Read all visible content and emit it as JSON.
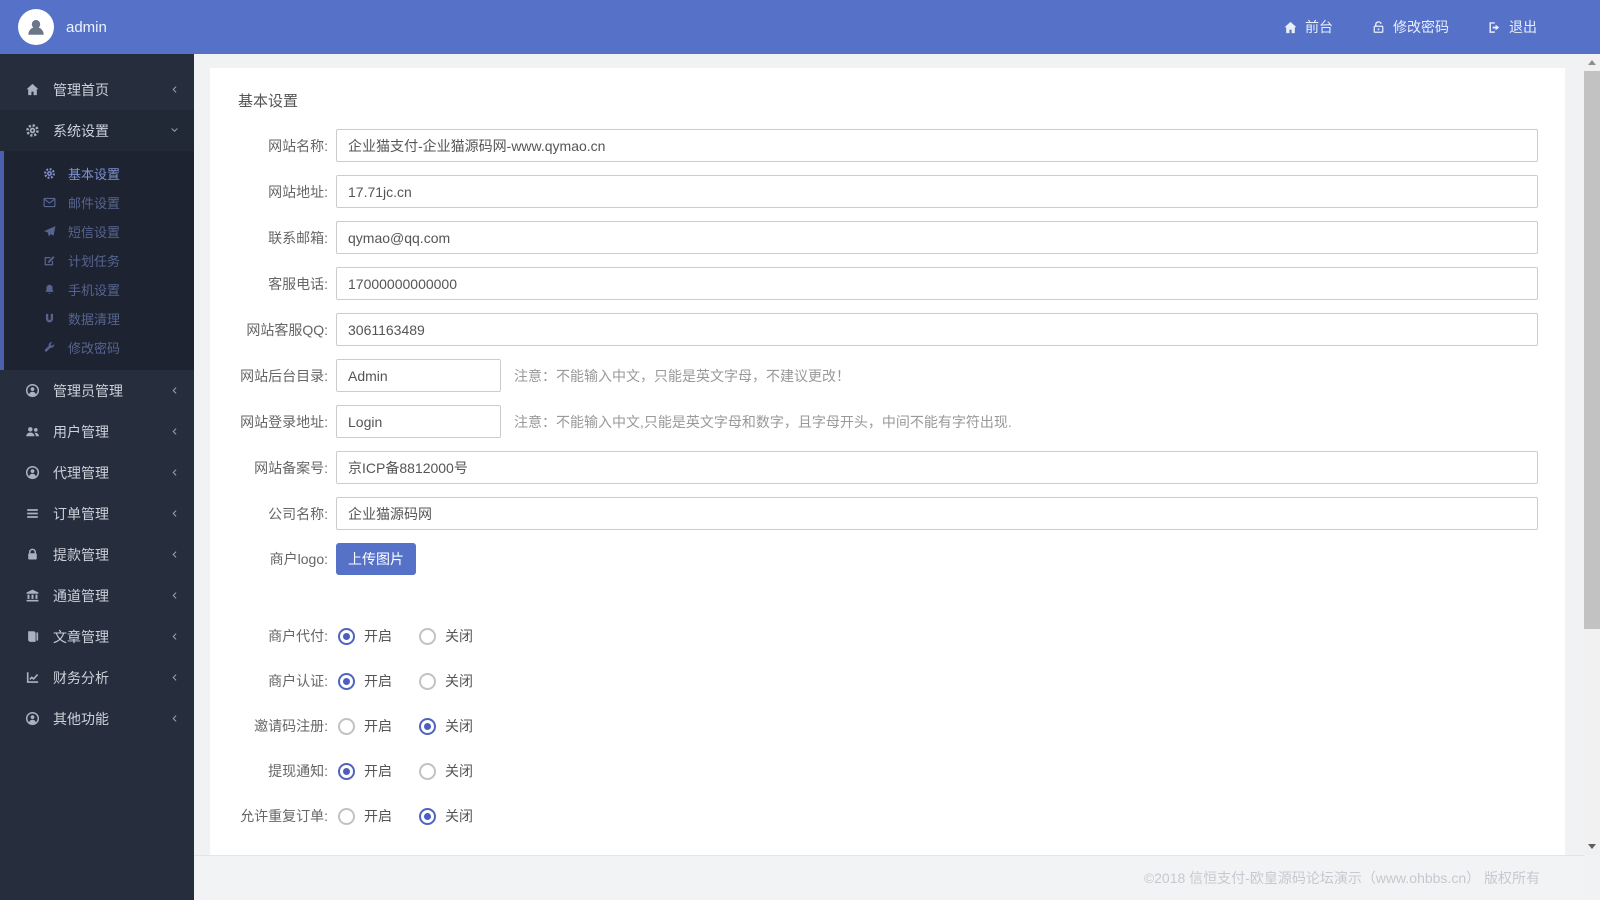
{
  "topbar": {
    "username": "admin",
    "nav": [
      {
        "label": "前台",
        "icon": "home-icon"
      },
      {
        "label": "修改密码",
        "icon": "unlock-icon"
      },
      {
        "label": "退出",
        "icon": "sign-out-icon"
      }
    ]
  },
  "sidebar": {
    "items": [
      {
        "label": "管理首页",
        "icon": "home-icon"
      },
      {
        "label": "系统设置",
        "icon": "gear-icon",
        "active": true,
        "submenu": [
          {
            "label": "基本设置",
            "icon": "gear-icon",
            "active": true
          },
          {
            "label": "邮件设置",
            "icon": "envelope-icon"
          },
          {
            "label": "短信设置",
            "icon": "paper-plane-icon"
          },
          {
            "label": "计划任务",
            "icon": "edit-icon"
          },
          {
            "label": "手机设置",
            "icon": "bell-icon"
          },
          {
            "label": "数据清理",
            "icon": "database-icon"
          },
          {
            "label": "修改密码",
            "icon": "wrench-icon"
          }
        ]
      },
      {
        "label": "管理员管理",
        "icon": "user-icon"
      },
      {
        "label": "用户管理",
        "icon": "users-icon"
      },
      {
        "label": "代理管理",
        "icon": "user-icon"
      },
      {
        "label": "订单管理",
        "icon": "list-icon"
      },
      {
        "label": "提款管理",
        "icon": "lock-icon"
      },
      {
        "label": "通道管理",
        "icon": "bank-icon"
      },
      {
        "label": "文章管理",
        "icon": "book-icon"
      },
      {
        "label": "财务分析",
        "icon": "chart-line-icon"
      },
      {
        "label": "其他功能",
        "icon": "user-icon"
      }
    ]
  },
  "main": {
    "heading": "基本设置",
    "fields": [
      {
        "label": "网站名称:",
        "value": "企业猫支付-企业猫源码网-www.qymao.cn",
        "size": "full"
      },
      {
        "label": "网站地址:",
        "value": "17.71jc.cn",
        "size": "full"
      },
      {
        "label": "联系邮箱:",
        "value": "qymao@qq.com",
        "size": "full"
      },
      {
        "label": "客服电话:",
        "value": "17000000000000",
        "size": "full"
      },
      {
        "label": "网站客服QQ:",
        "value": "3061163489",
        "size": "full"
      },
      {
        "label": "网站后台目录:",
        "value": "Admin",
        "size": "small",
        "note": "注意：不能输入中文，只能是英文字母，不建议更改！"
      },
      {
        "label": "网站登录地址:",
        "value": "Login",
        "size": "small",
        "note": "注意：不能输入中文,只能是英文字母和数字，且字母开头，中间不能有字符出现."
      },
      {
        "label": "网站备案号:",
        "value": "京ICP备8812000号",
        "size": "full"
      },
      {
        "label": "公司名称:",
        "value": "企业猫源码网",
        "size": "full"
      }
    ],
    "logo_field": {
      "label": "商户logo:",
      "button_label": "上传图片"
    },
    "radio_groups": [
      {
        "label": "商户代付:",
        "options": [
          "开启",
          "关闭"
        ],
        "selected": 0
      },
      {
        "label": "商户认证:",
        "options": [
          "开启",
          "关闭"
        ],
        "selected": 0
      },
      {
        "label": "邀请码注册:",
        "options": [
          "开启",
          "关闭"
        ],
        "selected": 1
      },
      {
        "label": "提现通知:",
        "options": [
          "开启",
          "关闭"
        ],
        "selected": 0
      },
      {
        "label": "允许重复订单:",
        "options": [
          "开启",
          "关闭"
        ],
        "selected": 1
      }
    ]
  },
  "footer": {
    "copyright": "©2018 信恒支付-欧皇源码论坛演示（www.ohbbs.cn） 版权所有"
  },
  "colors": {
    "topbar_bg": "#5672c8",
    "sidebar_bg": "#262d3c",
    "submenu_bg": "#1d2330",
    "accent": "#5672c8",
    "radio_selected": "#4a5fc0"
  }
}
